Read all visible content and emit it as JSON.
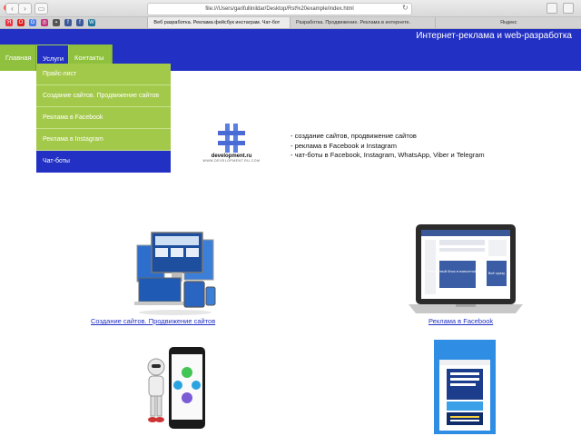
{
  "browser": {
    "url": "file:///Users/garifullinildar/Desktop/Rst%20example/index.html",
    "favorites": [
      "yandex-icon",
      "opera-icon",
      "google-icon",
      "instagram-icon",
      "generic-icon",
      "facebook-icon",
      "facebook-icon",
      "wordpress-icon"
    ],
    "tabs": [
      {
        "label": "Веб разработка. Реклама фейсбук инстаграм. Чат-бот",
        "active": true
      },
      {
        "label": "Разработка. Продвижение. Реклама в интернете.",
        "active": false
      },
      {
        "label": "Яндекс",
        "active": false
      }
    ]
  },
  "site": {
    "title": "Интернет-реклама и web-разработка",
    "nav": [
      {
        "label": "Главная",
        "active": false
      },
      {
        "label": "Услуги",
        "active": true
      },
      {
        "label": "Контакты",
        "active": false
      }
    ],
    "dropdown": [
      {
        "label": "Прайс-лист",
        "highlight": false
      },
      {
        "label": "Создание сайтов. Продвижение сайтов",
        "highlight": false
      },
      {
        "label": "Реклама в Facebook",
        "highlight": false
      },
      {
        "label": "Реклама в Instagram",
        "highlight": false
      },
      {
        "label": "Чат-боты",
        "highlight": true
      }
    ]
  },
  "hero": {
    "logo_name": "development.ru",
    "logo_sub": "WWW.DEVELOPMENT.RU.COM",
    "services": [
      "- создание сайтов, продвижение сайтов",
      "- реклама в Facebook и Instagram",
      "- чат-боты в Facebook, Instagram, WhatsApp, Viber и Telegram"
    ]
  },
  "showcase": {
    "web_link": "Создание сайтов. Продвижение сайтов",
    "fb_link": "Реклама в Facebook",
    "fb_ad_text": "Рекламный блок в новостной ленте",
    "fb_ad_button": "Всё сразу"
  },
  "colors": {
    "brand_blue": "#2230c3",
    "menu_green": "#8fc13e",
    "dropdown_green": "#a3c94a"
  }
}
